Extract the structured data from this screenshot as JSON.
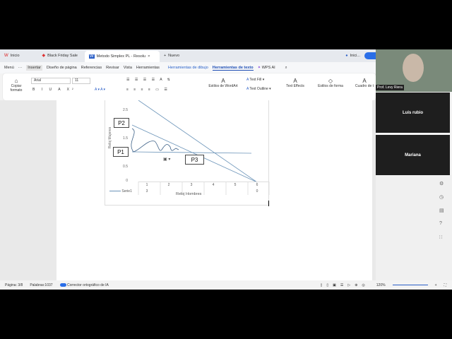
{
  "tabs": [
    {
      "label": "Inicio",
      "icon": "wps-logo-icon"
    },
    {
      "label": "Black Friday Sale",
      "icon": "tag-icon"
    },
    {
      "label": "Metodo Simplex PL - Resolu",
      "icon": "word-doc-icon",
      "active": true
    }
  ],
  "new_tab": "Nuevo",
  "account": "Inici...",
  "menu": {
    "menu": "Menú",
    "more": "···",
    "items": [
      "Insertar",
      "Diseño de página",
      "Referencias",
      "Revisar",
      "Vista",
      "Herramientas"
    ],
    "drawing": "Herramientas de dibujo",
    "text_tools": "Herramientas de texto",
    "wps_ai": "WPS AI"
  },
  "ribbon": {
    "copy_format": "Copiar formato",
    "font": "Arial",
    "size": "11",
    "wordart": "Estilos de WordArt",
    "text_fill": "Text Fill",
    "text_outline": "Text Outline",
    "text_effects": "Text Effects",
    "shape_styles": "Estilos de forma",
    "textbox": "Cuadro de t"
  },
  "chart_data": {
    "type": "line",
    "categories": [
      "1",
      "2",
      "3",
      "4",
      "5",
      "6"
    ],
    "series": [
      {
        "name": "Serie1",
        "values": [
          3,
          null,
          null,
          null,
          null,
          0
        ]
      }
    ],
    "xlabel": "Reloj  Hombres",
    "ylabel": "Reloj Mujeres",
    "yticks": [
      "2.5",
      "2",
      "1.5",
      "1",
      "0.5",
      "0"
    ],
    "ylim": [
      0,
      2.5
    ],
    "table_row": [
      "3",
      "",
      "",
      "",
      "",
      "0"
    ],
    "annotations": [
      "P1",
      "P2",
      "P3"
    ],
    "legend": "table-bottom"
  },
  "status": {
    "page": "Página: 3/8",
    "words": "Palabras:1037",
    "spell": "Corrector ortográfico de IA",
    "zoom": "120%"
  },
  "participants": {
    "host": "Prof. Levy Riera",
    "p1": "Luis rubio",
    "p2": "Mariana"
  }
}
